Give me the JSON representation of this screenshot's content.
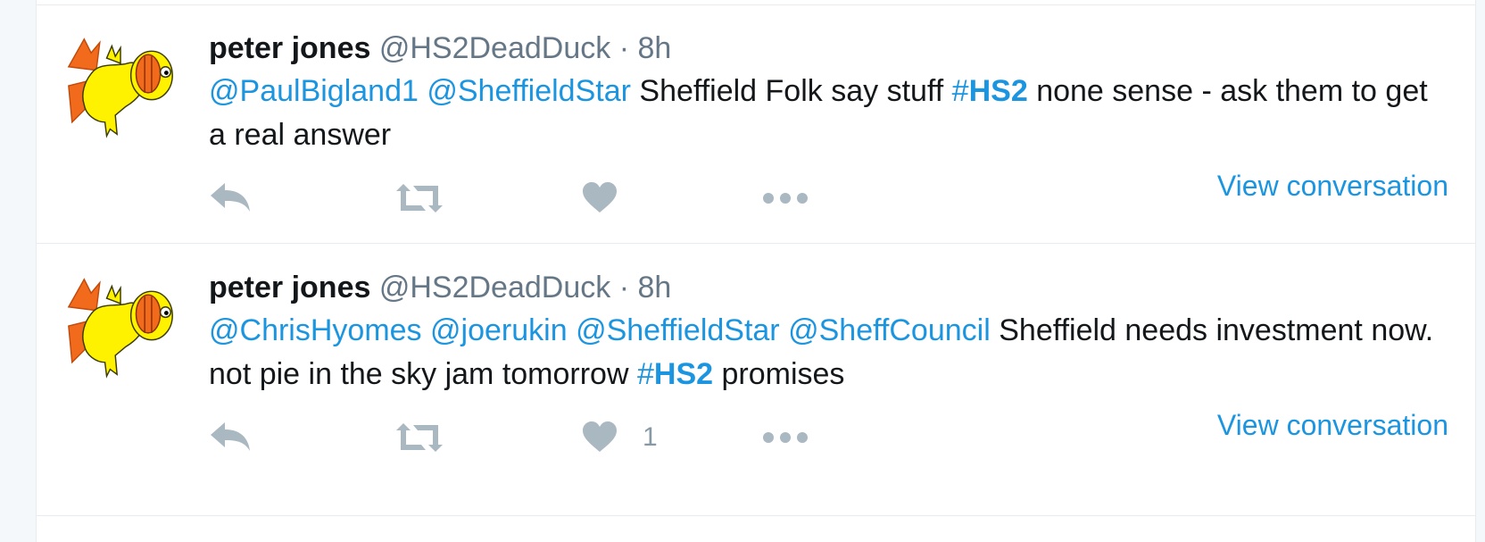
{
  "tweets": [
    {
      "name": "peter jones",
      "handle": "@HS2DeadDuck",
      "dot": "·",
      "time": "8h",
      "mentions": [
        "@PaulBigland1",
        "@SheffieldStar"
      ],
      "text_before_hash": "Sheffield Folk say stuff",
      "hash_symbol": "#",
      "hashtag": "HS2",
      "text_after_hash": "none sense - ask them to get a real answer",
      "like_count": "",
      "view_conversation": "View conversation"
    },
    {
      "name": "peter jones",
      "handle": "@HS2DeadDuck",
      "dot": "·",
      "time": "8h",
      "mentions": [
        "@ChrisHyomes",
        "@joerukin",
        "@SheffieldStar",
        "@SheffCouncil"
      ],
      "text_before_hash": "Sheffield needs investment now. not pie in the sky jam tomorrow",
      "hash_symbol": "#",
      "hashtag": "HS2",
      "text_after_hash": "promises",
      "like_count": "1",
      "view_conversation": "View conversation"
    }
  ],
  "icons": {
    "reply": "reply-icon",
    "retweet": "retweet-icon",
    "like": "heart-icon",
    "more": "more-dots-icon",
    "avatar": "duck-avatar"
  },
  "colors": {
    "link": "#1b95e0",
    "text": "#14171a",
    "muted": "#657786",
    "icon": "#aab8c2"
  }
}
